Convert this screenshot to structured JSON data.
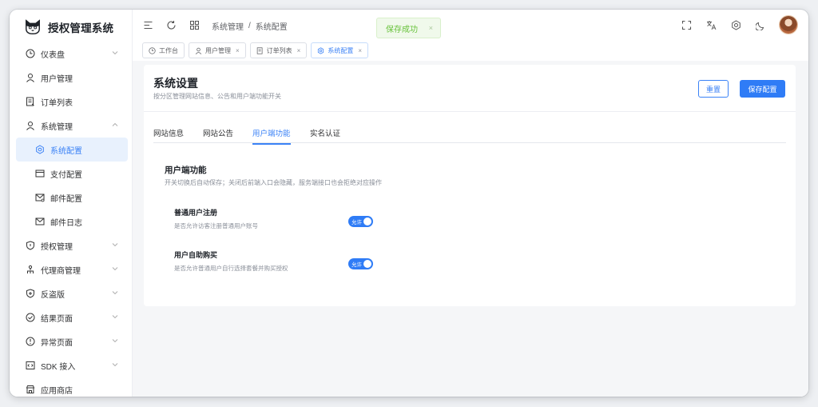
{
  "app": {
    "title": "授权管理系统"
  },
  "sidebar": {
    "items": [
      {
        "label": "仪表盘",
        "icon": "clock-icon",
        "chevron": "down"
      },
      {
        "label": "用户管理",
        "icon": "user-icon"
      },
      {
        "label": "订单列表",
        "icon": "order-list-icon"
      },
      {
        "label": "系统管理",
        "icon": "user-icon",
        "chevron": "up"
      },
      {
        "label": "系统配置",
        "icon": "settings-icon",
        "active": true,
        "sub": true
      },
      {
        "label": "支付配置",
        "icon": "payment-icon",
        "sub": true
      },
      {
        "label": "邮件配置",
        "icon": "mail-settings-icon",
        "sub": true
      },
      {
        "label": "邮件日志",
        "icon": "mail-icon",
        "sub": true
      },
      {
        "label": "授权管理",
        "icon": "shield-icon",
        "chevron": "down"
      },
      {
        "label": "代理商管理",
        "icon": "org-icon",
        "chevron": "down"
      },
      {
        "label": "反盗版",
        "icon": "shield-plus-icon",
        "chevron": "down"
      },
      {
        "label": "结果页面",
        "icon": "check-circle-icon",
        "chevron": "down"
      },
      {
        "label": "异常页面",
        "icon": "alert-circle-icon",
        "chevron": "down"
      },
      {
        "label": "SDK 接入",
        "icon": "code-icon",
        "chevron": "down"
      },
      {
        "label": "应用商店",
        "icon": "store-icon"
      }
    ]
  },
  "header": {
    "breadcrumb": [
      "系统管理",
      "系统配置"
    ],
    "breadcrumb_sep": "/"
  },
  "toast": {
    "message": "保存成功",
    "close": "×"
  },
  "page_tabs": [
    {
      "label": "工作台",
      "icon": "clock-icon",
      "closable": false
    },
    {
      "label": "用户管理",
      "icon": "user-icon",
      "closable": true
    },
    {
      "label": "订单列表",
      "icon": "order-list-icon",
      "closable": true
    },
    {
      "label": "系统配置",
      "icon": "settings-icon",
      "closable": true,
      "active": true
    }
  ],
  "page": {
    "title": "系统设置",
    "subtitle": "按分区管理网站信息、公告和用户端功能开关",
    "reset_label": "重置",
    "save_label": "保存配置"
  },
  "settings_tabs": [
    {
      "label": "网站信息"
    },
    {
      "label": "网站公告"
    },
    {
      "label": "用户端功能",
      "active": true
    },
    {
      "label": "实名认证"
    }
  ],
  "section": {
    "title": "用户端功能",
    "description": "开关切换后自动保存；关闭后前端入口会隐藏，服务端接口也会拒绝对应操作",
    "settings": [
      {
        "title": "普通用户注册",
        "description": "是否允许访客注册普通用户账号",
        "switch_label": "允许",
        "enabled": true
      },
      {
        "title": "用户自助购买",
        "description": "是否允许普通用户自行选择套餐并购买授权",
        "switch_label": "允许",
        "enabled": true
      }
    ]
  },
  "colors": {
    "accent": "#2f7cf6",
    "success_text": "#67c23a",
    "success_bg": "#f0f9eb",
    "active_bg": "#e8f1fd"
  }
}
